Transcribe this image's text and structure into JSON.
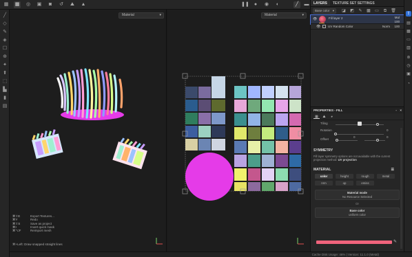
{
  "top_toolbar": {
    "icons": [
      "grid-icon",
      "grid-alt-icon",
      "grid-ring-icon",
      "image-icon",
      "camera-icon",
      "history-icon",
      "mountain-icon",
      "mountain-alt-icon"
    ],
    "right_icons": [
      "pause-icon",
      "dot-icon",
      "capture-icon",
      "sphere-icon",
      "pen-icon",
      "bar-icon"
    ]
  },
  "viewport3d": {
    "material_dropdown": "Material"
  },
  "viewport2d": {
    "material_dropdown": "Material"
  },
  "shortcuts": [
    {
      "key": "⌘⇧E",
      "label": "Export Textures..."
    },
    {
      "key": "⌘Y",
      "label": "Redo"
    },
    {
      "key": "⌘⇧S",
      "label": "Save as project"
    },
    {
      "key": "⌘I",
      "label": "Invert quick mask"
    },
    {
      "key": "⌘⌥F",
      "label": "Reimport mesh"
    }
  ],
  "hint": "⌘+Left: Draw snapped straight lines",
  "status": "Cache Disk Usage:  46% | Version: 11.1.0 (Metal)",
  "layers_panel": {
    "tabs": [
      "LAYERS",
      "TEXTURE SET SETTINGS"
    ],
    "channel": "Base color",
    "fill_layer": {
      "name": "Fill layer 2",
      "blend": "Mul",
      "opacity": "100"
    },
    "sub_layer": {
      "name": "UV Random Color",
      "blend": "Norm",
      "opacity": "100"
    }
  },
  "properties": {
    "title": "PROPERTIES - FILL",
    "rows": {
      "tiling": "Tiling",
      "rotation": "Rotation",
      "rotation_value": "0",
      "offset": "Offset",
      "offset_x": "0",
      "offset_y": "0"
    },
    "symmetry_title": "SYMMETRY",
    "symmetry_text": "Fill layer symmetry options are not available with the current projection method:",
    "symmetry_method": "UV projection",
    "material_title": "MATERIAL",
    "channels": [
      "color",
      "height",
      "rough",
      "metal",
      "nrm",
      "op",
      "emiss"
    ],
    "material_mode_title": "Material mode",
    "material_mode_value": "No Resource Selected",
    "or_text": "Or",
    "base_color_title": "Base color",
    "base_color_value": "uniform color",
    "base_color_hex": "#f0637c"
  },
  "colors": {
    "accent": "#2e6fd8",
    "magenta": "#e53be8"
  }
}
